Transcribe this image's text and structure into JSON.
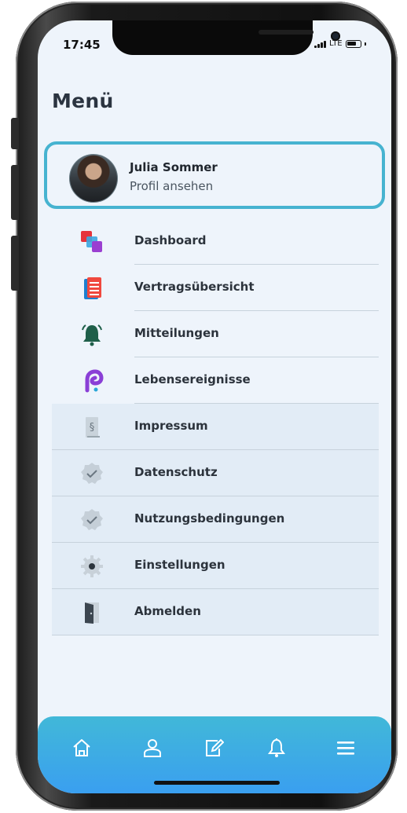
{
  "status_bar": {
    "time": "17:45",
    "network": "LTE"
  },
  "header": {
    "title": "Menü"
  },
  "profile": {
    "name": "Julia Sommer",
    "subtitle": "Profil ansehen"
  },
  "menu": {
    "items": [
      {
        "label": "Dashboard",
        "icon": "dashboard-icon"
      },
      {
        "label": "Vertragsübersicht",
        "icon": "contract-icon"
      },
      {
        "label": "Mitteilungen",
        "icon": "bell-icon"
      },
      {
        "label": "Lebensereignisse",
        "icon": "life-events-icon"
      },
      {
        "label": "Impressum",
        "icon": "legal-notice-icon"
      },
      {
        "label": "Datenschutz",
        "icon": "privacy-check-icon"
      },
      {
        "label": "Nutzungsbedingungen",
        "icon": "terms-check-icon"
      },
      {
        "label": "Einstellungen",
        "icon": "settings-gear-icon"
      },
      {
        "label": "Abmelden",
        "icon": "logout-door-icon"
      }
    ]
  },
  "tab_bar": {
    "tabs": [
      {
        "icon": "home-icon"
      },
      {
        "icon": "profile-icon"
      },
      {
        "icon": "edit-document-icon"
      },
      {
        "icon": "notification-bell-icon"
      },
      {
        "icon": "menu-icon",
        "active": true
      }
    ]
  },
  "colors": {
    "accent": "#46b3d0",
    "tab_bar_top": "#41b8d8",
    "tab_bar_bottom": "#3a9ff0",
    "screen_background": "#eef4fb",
    "secondary_section": "#e2ecf6"
  }
}
